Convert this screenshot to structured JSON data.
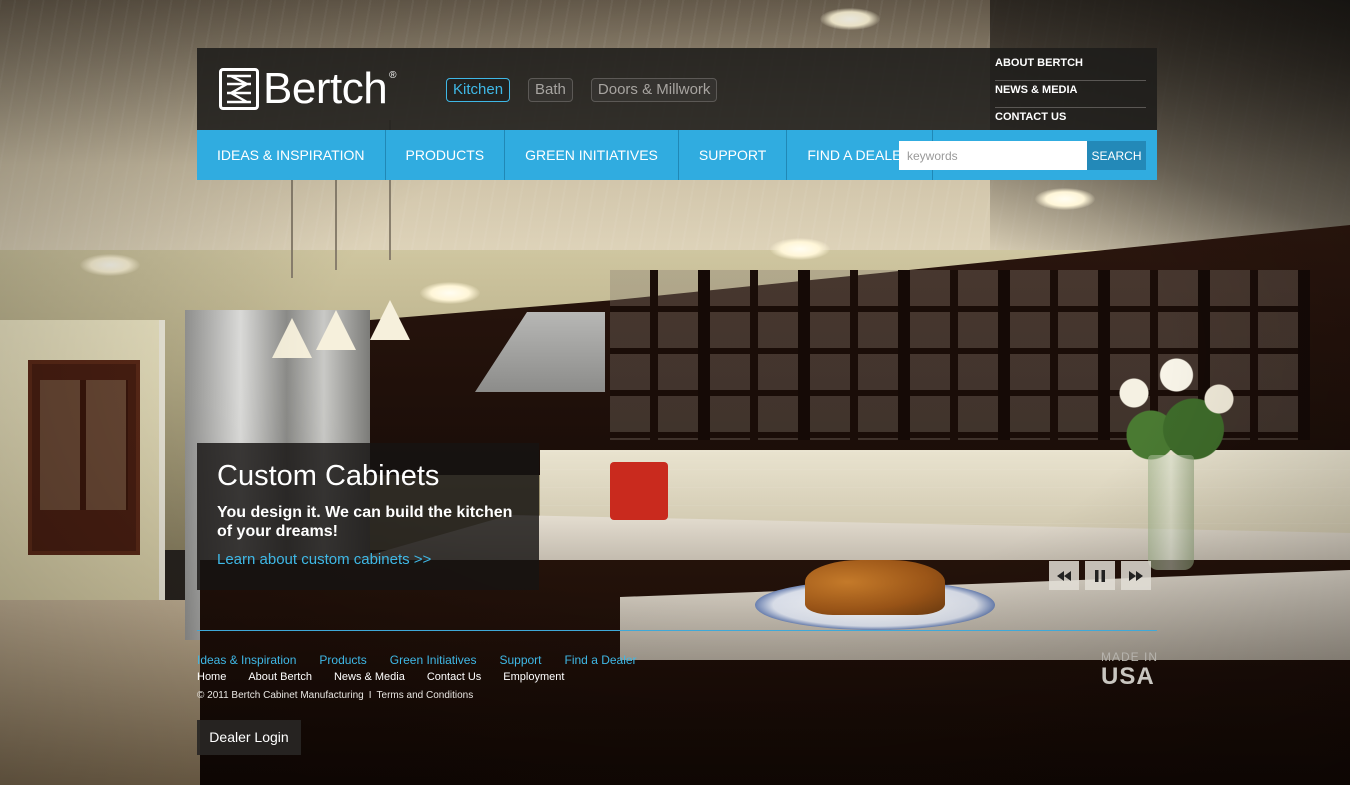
{
  "header": {
    "brand": "Bertch",
    "registered": "®",
    "category_tabs": [
      {
        "label": "Kitchen",
        "active": true
      },
      {
        "label": "Bath",
        "active": false
      },
      {
        "label": "Doors & Millwork",
        "active": false
      }
    ],
    "utility_links": [
      "ABOUT BERTCH",
      "NEWS & MEDIA",
      "CONTACT US"
    ]
  },
  "nav": {
    "items": [
      "IDEAS & INSPIRATION",
      "PRODUCTS",
      "GREEN INITIATIVES",
      "SUPPORT",
      "FIND A DEALER"
    ],
    "search_placeholder": "keywords",
    "search_button": "SEARCH"
  },
  "feature": {
    "title": "Custom Cabinets",
    "text": "You design it. We can build the kitchen of your dreams!",
    "link": "Learn about custom cabinets >>"
  },
  "slideshow_controls": [
    "rewind-icon",
    "pause-icon",
    "fast-forward-icon"
  ],
  "footer": {
    "primary_links": [
      "Ideas & Inspiration",
      "Products",
      "Green Initiatives",
      "Support",
      "Find a Dealer"
    ],
    "secondary_links": [
      "Home",
      "About Bertch",
      "News & Media",
      "Contact Us",
      "Employment"
    ],
    "copyright": "© 2011 Bertch Cabinet Manufacturing",
    "separator": "I",
    "terms": "Terms and Conditions",
    "made_in_top": "MADE IN",
    "made_in_bottom": "USA",
    "dealer_login": "Dealer Login"
  },
  "colors": {
    "accent_blue": "#30ace0",
    "link_blue": "#3fb8e6",
    "header_bg": "#1e1c1a"
  }
}
